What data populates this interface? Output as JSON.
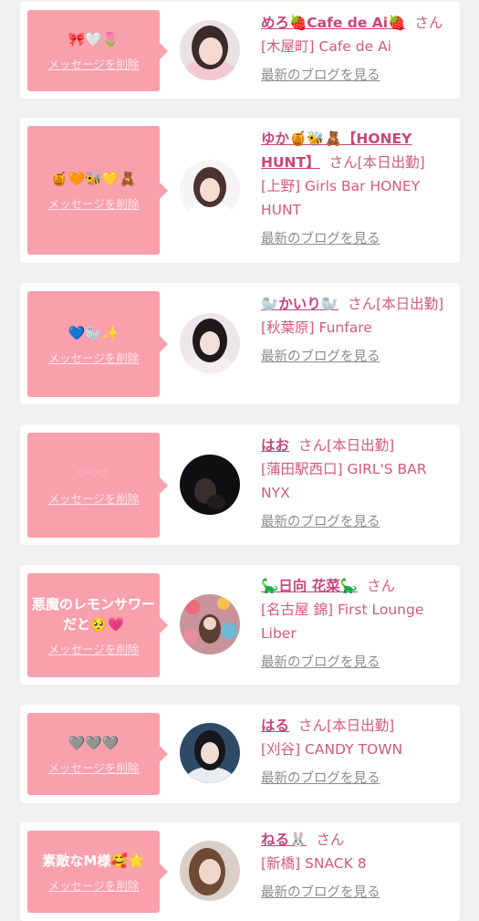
{
  "cards": [
    {
      "message": "🎀🤍🌷",
      "delete_label": "メッセージを削除",
      "name": "めろ🍓Cafe de Ai🍓",
      "honorific": "さん",
      "status": "",
      "store": "[木屋町] Cafe de Ai",
      "latest_blog": "最新のブログを見る"
    },
    {
      "message": "🍯🧡🐝💛🧸",
      "delete_label": "メッセージを削除",
      "name": "ゆか🍯🐝🧸【HONEY HUNT】",
      "honorific": "さん",
      "status": "[本日出勤]",
      "store": "[上野] Girls Bar HONEY HUNT",
      "latest_blog": "最新のブログを見る"
    },
    {
      "message": "💙🦭✨",
      "delete_label": "メッセージを削除",
      "name": "🦭かいり🦭",
      "honorific": "さん",
      "status": "[本日出勤]",
      "store": "[秋葉原] Funfare",
      "latest_blog": "最新のブログを見る"
    },
    {
      "message": "♡♡♡",
      "delete_label": "メッセージを削除",
      "name": "はお",
      "honorific": "さん",
      "status": "[本日出勤]",
      "store": "[蒲田駅西口] GIRL'S BAR NYX",
      "latest_blog": "最新のブログを見る"
    },
    {
      "message": "悪魔のレモンサワーだと🥺💗",
      "delete_label": "メッセージを削除",
      "name": "🦕日向 花菜🦕",
      "honorific": "さん",
      "status": "",
      "store": "[名古屋 錦] First Lounge Liber",
      "latest_blog": "最新のブログを見る"
    },
    {
      "message": "🩶🩶🩶",
      "delete_label": "メッセージを削除",
      "name": "はる",
      "honorific": "さん",
      "status": "[本日出勤]",
      "store": "[刈谷] CANDY TOWN",
      "latest_blog": "最新のブログを見る"
    },
    {
      "message": "素敵なM様🥰🌟",
      "delete_label": "メッセージを削除",
      "name": "ねる🐰",
      "honorific": "さん",
      "status": "",
      "store": "[新橋] SNACK 8",
      "latest_blog": "最新のブログを見る"
    }
  ],
  "colors": {
    "bubble": "#f9a0ad",
    "name": "#c8467a",
    "text": "#d45a79",
    "link_gray": "#8c8c8c",
    "background": "#f1f1f1"
  }
}
